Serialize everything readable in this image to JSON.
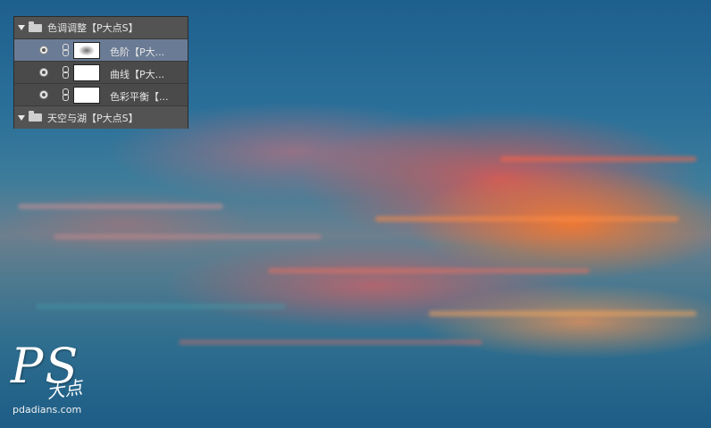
{
  "layers_panel": {
    "group1": {
      "name": "色调调整【P大点S】",
      "expanded": true
    },
    "layers": [
      {
        "name": "色阶【P大...",
        "thumb": "levels-mask",
        "selected": true
      },
      {
        "name": "曲线【P大...",
        "thumb": "white-mask",
        "selected": false
      },
      {
        "name": "色彩平衡【...",
        "thumb": "white-mask",
        "selected": false
      }
    ],
    "group2": {
      "name": "天空与湖【P大点S】",
      "expanded": true
    },
    "colors": {
      "panel": "#4a4a4a",
      "selected": "#6a7b95"
    },
    "icons": {
      "disclosure": "triangle-down-icon",
      "folder": "folder-icon",
      "visibility": "eye-icon",
      "link": "chain-link-icon"
    }
  },
  "watermark": {
    "logo": "PS",
    "chinese": "大点",
    "url": "pdadians.com"
  }
}
